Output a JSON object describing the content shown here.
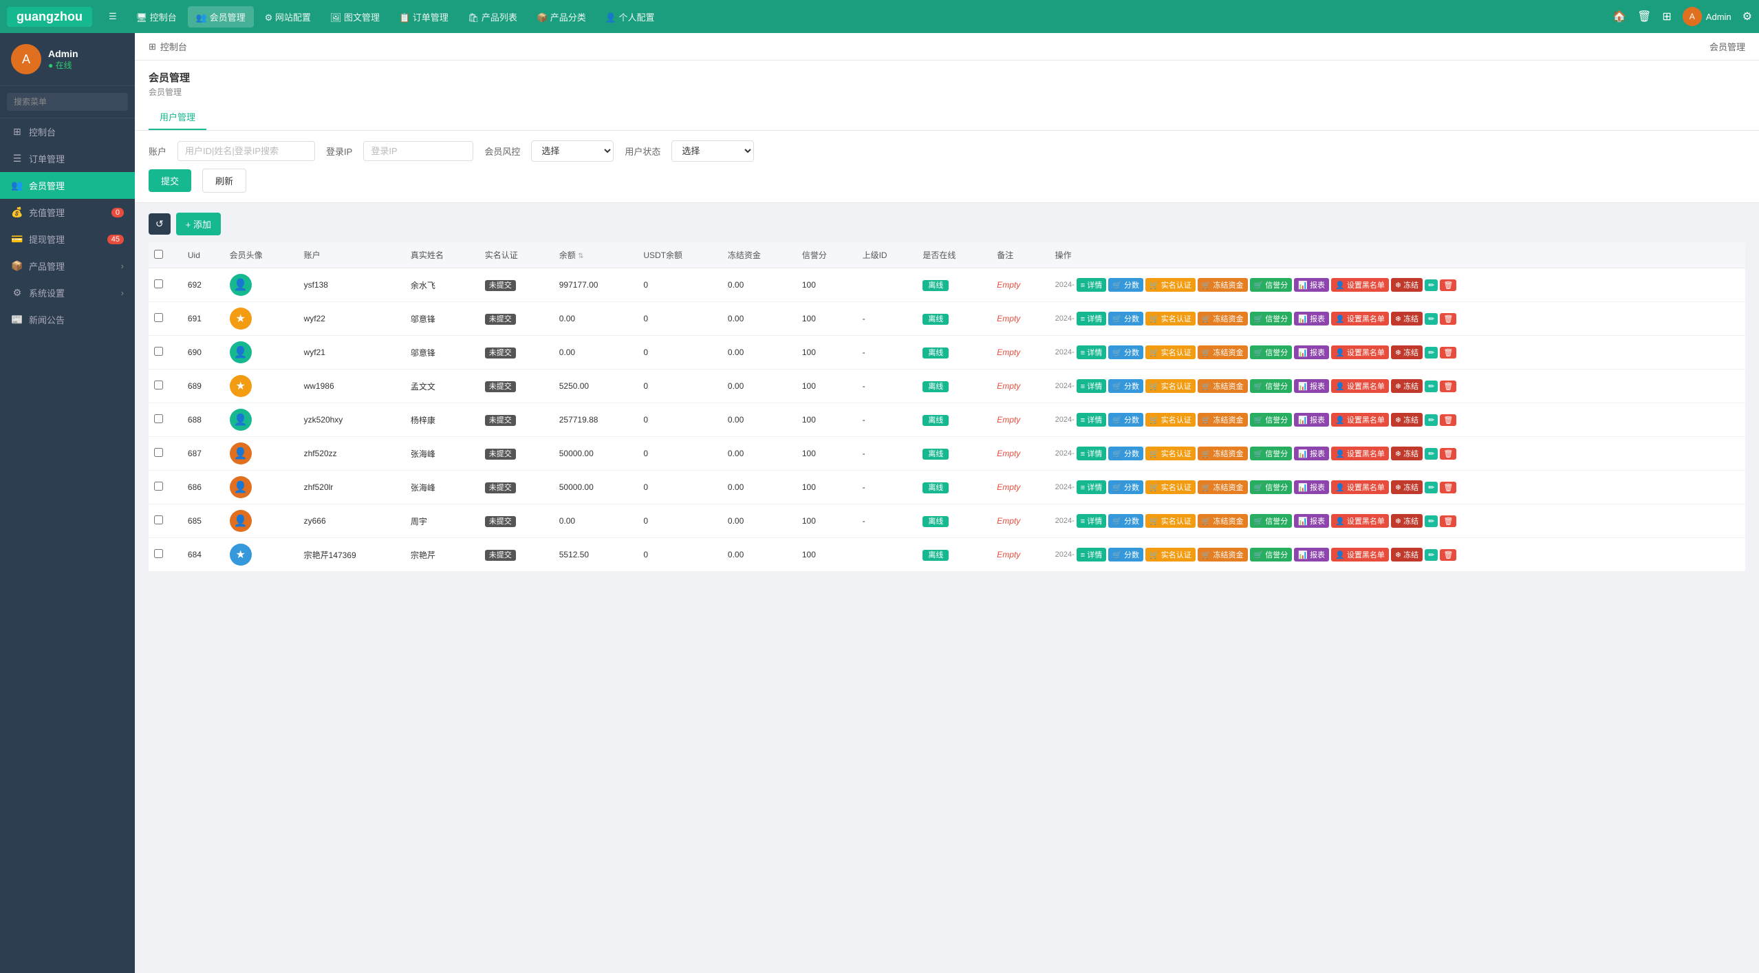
{
  "brand": "guangzhou",
  "topNav": {
    "items": [
      {
        "label": "☰",
        "icon": "menu-icon",
        "key": "menu"
      },
      {
        "label": "🖥 控制台",
        "icon": "dashboard-icon",
        "key": "dashboard"
      },
      {
        "label": "👥 会员管理",
        "icon": "member-icon",
        "key": "member",
        "active": true
      },
      {
        "label": "⚙ 网站配置",
        "icon": "config-icon",
        "key": "config"
      },
      {
        "label": "🖼 图文管理",
        "icon": "media-icon",
        "key": "media"
      },
      {
        "label": "📋 订单管理",
        "icon": "order-icon",
        "key": "order"
      },
      {
        "label": "🛍 产品列表",
        "icon": "product-icon",
        "key": "product"
      },
      {
        "label": "📦 产品分类",
        "icon": "category-icon",
        "key": "category"
      },
      {
        "label": "👤 个人配置",
        "icon": "personal-icon",
        "key": "personal"
      }
    ],
    "rightIcons": [
      "🏠",
      "🗑",
      "⊞"
    ],
    "adminLabel": "Admin"
  },
  "sidebar": {
    "user": {
      "name": "Admin",
      "status": "在线"
    },
    "searchPlaceholder": "搜索菜单",
    "items": [
      {
        "label": "控制台",
        "icon": "⊞",
        "key": "dashboard",
        "active": false
      },
      {
        "label": "订单管理",
        "icon": "☰",
        "key": "order",
        "active": false
      },
      {
        "label": "会员管理",
        "icon": "👥",
        "key": "member",
        "active": true
      },
      {
        "label": "充值管理",
        "icon": "💰",
        "key": "recharge",
        "active": false,
        "badge": "0"
      },
      {
        "label": "提现管理",
        "icon": "💳",
        "key": "withdraw",
        "active": false,
        "badge": "45"
      },
      {
        "label": "产品管理",
        "icon": "📦",
        "key": "product",
        "active": false,
        "hasArrow": true
      },
      {
        "label": "系统设置",
        "icon": "⚙",
        "key": "system",
        "active": false,
        "hasArrow": true
      },
      {
        "label": "新闻公告",
        "icon": "📰",
        "key": "news",
        "active": false
      }
    ]
  },
  "breadcrumb": {
    "home": "控制台",
    "current": "会员管理",
    "right": "会员管理"
  },
  "pageHeader": {
    "title": "会员管理",
    "subtitle": "会员管理",
    "tabs": [
      {
        "label": "用户管理",
        "active": true
      }
    ]
  },
  "filters": {
    "accountLabel": "账户",
    "accountPlaceholder": "用户ID|姓名|登录IP搜索",
    "loginIpLabel": "登录IP",
    "loginIpPlaceholder": "登录IP",
    "memberRiskLabel": "会员风控",
    "memberRiskPlaceholder": "选择",
    "userStatusLabel": "用户状态",
    "userStatusPlaceholder": "选择",
    "submitLabel": "提交",
    "refreshLabel": "刷新"
  },
  "toolbar": {
    "reloadTitle": "↺",
    "addLabel": "+ 添加"
  },
  "tableHeaders": [
    "Uid",
    "会员头像",
    "账户",
    "真实姓名",
    "实名认证",
    "余额",
    "USDT余额",
    "冻结资金",
    "信誉分",
    "上级ID",
    "是否在线",
    "备注",
    "操作"
  ],
  "members": [
    {
      "uid": "692",
      "avatar": "teal",
      "account": "ysf138",
      "realName": "余水飞",
      "verify": "未提交",
      "balance": "997177.00",
      "usdtBalance": "0",
      "frozenFunds": "0.00",
      "creditScore": "100",
      "parentId": "",
      "online": true,
      "note": "Empty",
      "date": "2024-"
    },
    {
      "uid": "691",
      "avatar": "yellow",
      "account": "wyf22",
      "realName": "邬意锋",
      "verify": "未提交",
      "balance": "0.00",
      "usdtBalance": "0",
      "frozenFunds": "0.00",
      "creditScore": "100",
      "parentId": "-",
      "online": true,
      "note": "Empty",
      "date": "2024-"
    },
    {
      "uid": "690",
      "avatar": "teal",
      "account": "wyf21",
      "realName": "邬意锋",
      "verify": "未提交",
      "balance": "0.00",
      "usdtBalance": "0",
      "frozenFunds": "0.00",
      "creditScore": "100",
      "parentId": "-",
      "online": true,
      "note": "Empty",
      "date": "2024-"
    },
    {
      "uid": "689",
      "avatar": "yellow",
      "account": "ww1986",
      "realName": "孟文文",
      "verify": "未提交",
      "balance": "5250.00",
      "usdtBalance": "0",
      "frozenFunds": "0.00",
      "creditScore": "100",
      "parentId": "-",
      "online": true,
      "note": "Empty",
      "date": "2024-"
    },
    {
      "uid": "688",
      "avatar": "teal",
      "account": "yzk520hxy",
      "realName": "杨梓康",
      "verify": "未提交",
      "balance": "257719.88",
      "usdtBalance": "0",
      "frozenFunds": "0.00",
      "creditScore": "100",
      "parentId": "-",
      "online": true,
      "note": "Empty",
      "date": "2024-"
    },
    {
      "uid": "687",
      "avatar": "orange",
      "account": "zhf520zz",
      "realName": "张海峰",
      "verify": "未提交",
      "balance": "50000.00",
      "usdtBalance": "0",
      "frozenFunds": "0.00",
      "creditScore": "100",
      "parentId": "-",
      "online": true,
      "note": "Empty",
      "date": "2024-"
    },
    {
      "uid": "686",
      "avatar": "orange",
      "account": "zhf520lr",
      "realName": "张海峰",
      "verify": "未提交",
      "balance": "50000.00",
      "usdtBalance": "0",
      "frozenFunds": "0.00",
      "creditScore": "100",
      "parentId": "-",
      "online": true,
      "note": "Empty",
      "date": "2024-"
    },
    {
      "uid": "685",
      "avatar": "orange",
      "account": "zy666",
      "realName": "周宇",
      "verify": "未提交",
      "balance": "0.00",
      "usdtBalance": "0",
      "frozenFunds": "0.00",
      "creditScore": "100",
      "parentId": "-",
      "online": true,
      "note": "Empty",
      "date": "2024-"
    },
    {
      "uid": "684",
      "avatar": "blue",
      "account": "宗艳芹147369",
      "realName": "宗艳芹",
      "verify": "未提交",
      "balance": "5512.50",
      "usdtBalance": "0",
      "frozenFunds": "0.00",
      "creditScore": "100",
      "parentId": "",
      "online": true,
      "note": "Empty",
      "date": "2024-"
    }
  ],
  "actionButtons": {
    "detail": "详情",
    "score": "分数",
    "realname": "实名认证",
    "settle": "冻结资金",
    "credit": "信誉分",
    "report": "报表",
    "blacklist": "设置黑名单",
    "freeze": "冻结"
  }
}
